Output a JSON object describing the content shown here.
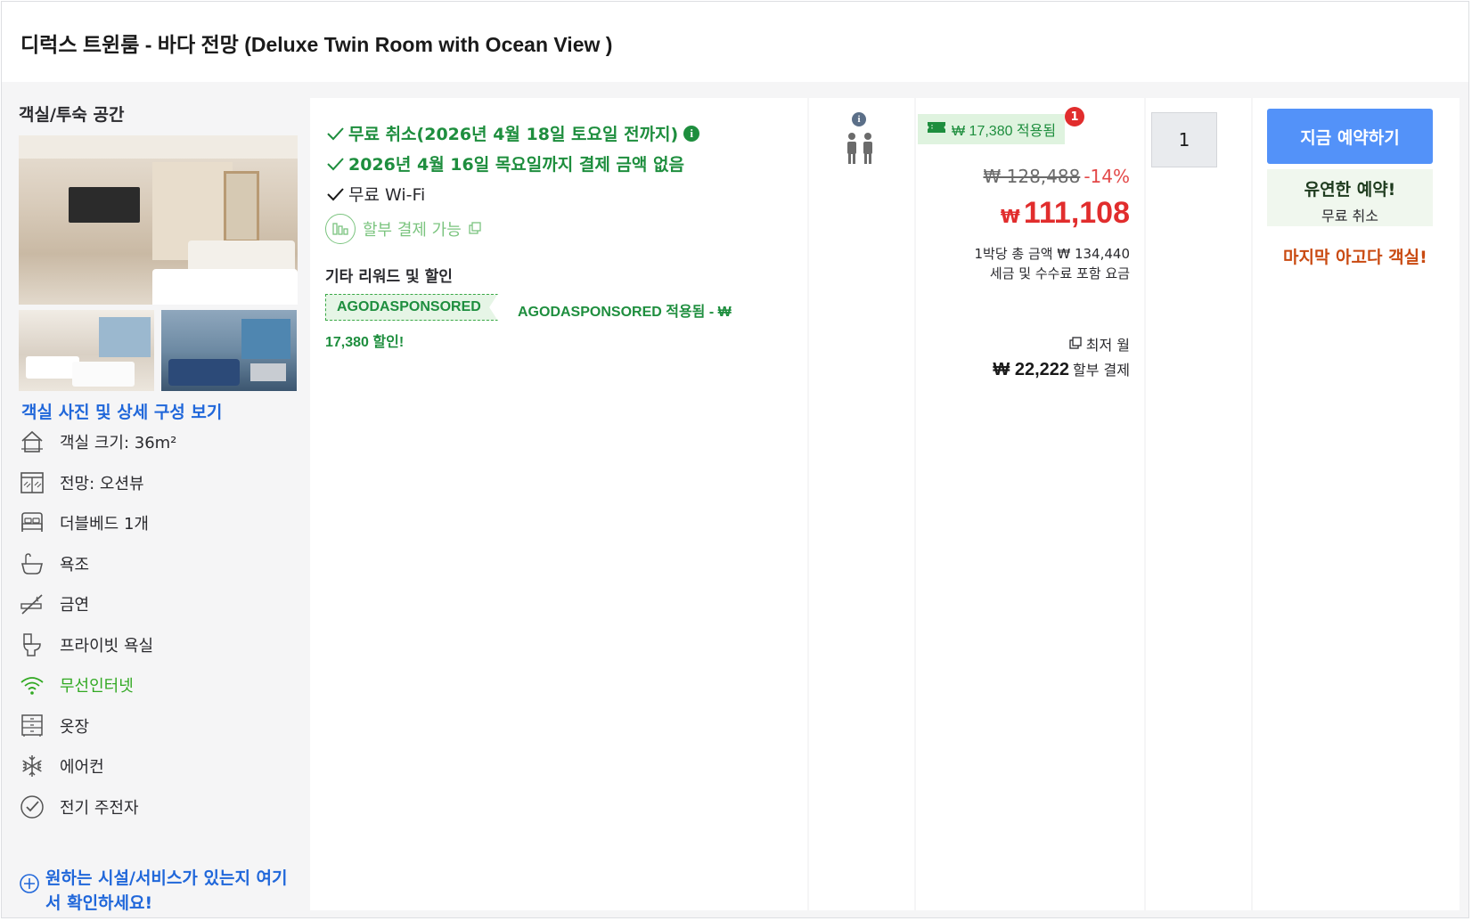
{
  "room": {
    "title": "디럭스 트윈룸 - 바다 전망 (Deluxe Twin Room with Ocean View )",
    "type_label": "객실/투숙 공간",
    "view_photos_link": "객실 사진 및 상세 구성 보기",
    "features": [
      {
        "icon": "house-icon",
        "label": "객실 크기: 36m²"
      },
      {
        "icon": "window-view-icon",
        "label": "전망: 오션뷰"
      },
      {
        "icon": "bed-icon",
        "label": "더블베드 1개"
      },
      {
        "icon": "bathtub-icon",
        "label": "욕조"
      },
      {
        "icon": "no-smoking-icon",
        "label": "금연"
      },
      {
        "icon": "toilet-icon",
        "label": "프라이빗 욕실"
      },
      {
        "icon": "wifi-icon",
        "label": "무선인터넷",
        "color": "#32a923"
      },
      {
        "icon": "wardrobe-icon",
        "label": "옷장"
      },
      {
        "icon": "snowflake-icon",
        "label": "에어컨"
      },
      {
        "icon": "kettle-check-icon",
        "label": "전기 주전자"
      }
    ],
    "more_link": "원하는 시설/서비스가 있는지 여기서 확인하세요!"
  },
  "benefits": {
    "free_cancel": "무료 취소(2026년 4월 18일 토요일 전까지)",
    "pay_later": "2026년 4월 16일 목요일까지 결제 금액 없음",
    "wifi": "무료 Wi-Fi",
    "installment": "할부 결제 가능",
    "other_rewards_title": "기타 리워드 및 할인",
    "promo_code": "AGODASPONSORED",
    "promo_text": "AGODASPONSORED 적용됨 - ₩ 17,380 할인!"
  },
  "guests": {
    "info_icon": "i",
    "count": 2
  },
  "price": {
    "coupon_text": "₩ 17,380 적용됨",
    "coupon_badge": "1",
    "original": "₩ 128,488",
    "discount": "-14%",
    "currency": "₩",
    "final": "111,108",
    "per_night": "1박당 총 금액 ₩ 134,440",
    "tax_note": "세금 및 수수료 포함 요금",
    "lowest_month": "최저 월",
    "monthly_amount": "₩ 22,222",
    "monthly_label": "할부 결제"
  },
  "quantity": {
    "value": "1"
  },
  "booking": {
    "book_button": "지금 예약하기",
    "flex_title": "유연한 예약!",
    "flex_sub": "무료 취소",
    "last_room": "마지막 아고다 객실!"
  },
  "colors": {
    "accent_blue": "#5392f9",
    "link_blue": "#2067da",
    "green": "#1e8e3e",
    "red": "#e12d2d",
    "orange": "#c94a11"
  }
}
